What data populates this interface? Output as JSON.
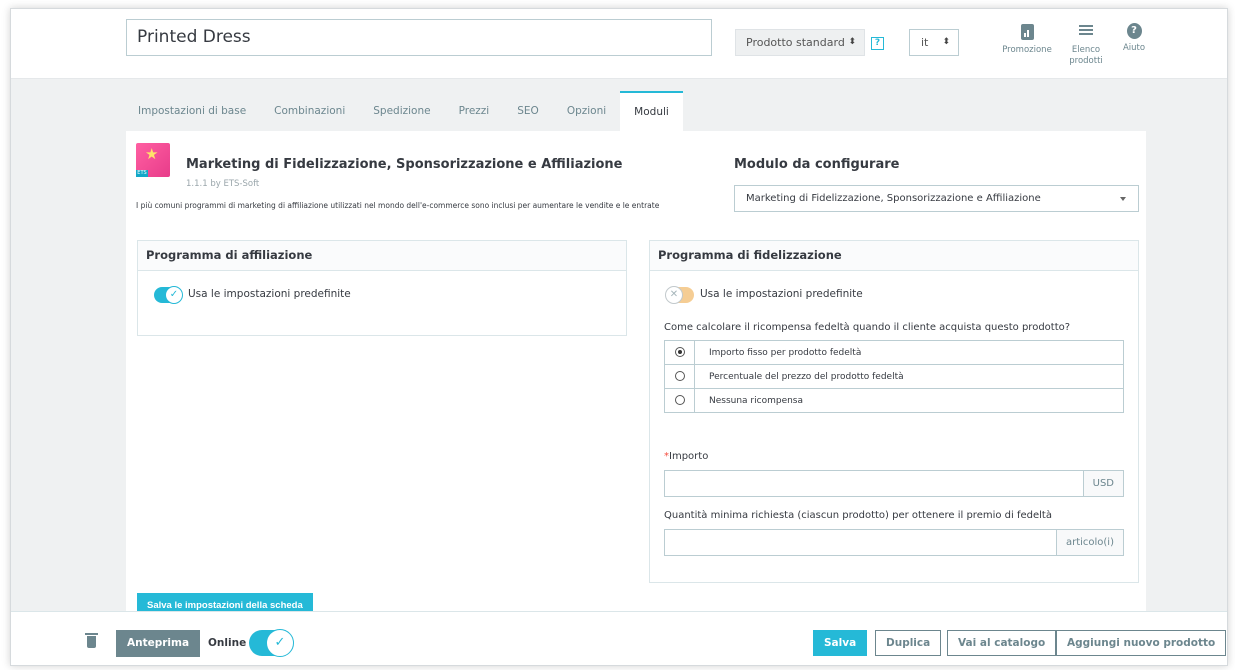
{
  "header": {
    "product_name": "Printed Dress",
    "product_type": "Prodotto standard",
    "type_arrows": "⬍",
    "help_badge": "?",
    "language": "it",
    "tools": [
      {
        "label": "Promozione",
        "icon": "chart-icon"
      },
      {
        "label": "Elenco prodotti",
        "icon": "list-icon"
      },
      {
        "label": "Aiuto",
        "icon": "help-icon"
      }
    ]
  },
  "tabs": [
    {
      "label": "Impostazioni di base",
      "active": false
    },
    {
      "label": "Combinazioni",
      "active": false
    },
    {
      "label": "Spedizione",
      "active": false
    },
    {
      "label": "Prezzi",
      "active": false
    },
    {
      "label": "SEO",
      "active": false
    },
    {
      "label": "Opzioni",
      "active": false
    },
    {
      "label": "Moduli",
      "active": true
    }
  ],
  "module": {
    "title": "Marketing di Fidelizzazione, Sponsorizzazione e Affiliazione",
    "version": "1.1.1 by ETS-Soft",
    "description": "I più comuni programmi di marketing di affiliazione utilizzati nel mondo dell'e-commerce sono inclusi per aumentare le vendite e le entrate",
    "logo_badge": "ETS"
  },
  "configure": {
    "title": "Modulo da configurare",
    "selected": "Marketing di Fidelizzazione, Sponsorizzazione e Affiliazione"
  },
  "affiliate_panel": {
    "title": "Programma di affiliazione",
    "toggle_label": "Usa le impostazioni predefinite",
    "toggle_on": true
  },
  "loyalty_panel": {
    "title": "Programma di fidelizzazione",
    "toggle_label": "Usa le impostazioni predefinite",
    "toggle_on": false,
    "question": "Come calcolare il ricompensa fedeltà quando il cliente acquista questo prodotto?",
    "options": [
      {
        "label": "Importo fisso per prodotto fedeltà",
        "checked": true
      },
      {
        "label": "Percentuale del prezzo del prodotto fedeltà",
        "checked": false
      },
      {
        "label": "Nessuna ricompensa",
        "checked": false
      }
    ],
    "amount_required_mark": "*",
    "amount_label": "Importo",
    "amount_value": "",
    "amount_addon": "USD",
    "min_qty_label": "Quantità minima richiesta (ciascun prodotto) per ottenere il premio di fedeltà",
    "min_qty_value": "",
    "min_qty_addon": "articolo(i)"
  },
  "save_tab_label": "Salva le impostazioni della scheda",
  "footer": {
    "preview_label": "Anteprima",
    "online_label": "Online",
    "online_on": true,
    "save_label": "Salva",
    "duplicate_label": "Duplica",
    "catalog_label": "Vai al catalogo",
    "new_product_label": "Aggiungi nuovo prodotto"
  },
  "colors": {
    "accent": "#25b9d7",
    "muted": "#6c868e",
    "required": "#f54c3e"
  }
}
